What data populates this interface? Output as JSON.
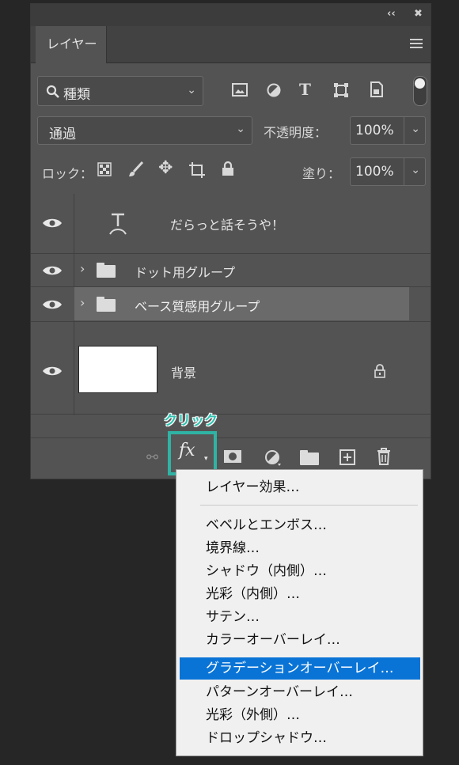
{
  "panel": {
    "topbar": {
      "collapse_label": "‹‹",
      "close_label": "✖"
    },
    "tab_label": "レイヤー",
    "filter": {
      "label": "種類"
    },
    "blend_mode": "通過",
    "opacity": {
      "label": "不透明度：",
      "value": "100%"
    },
    "lock": {
      "label": "ロック："
    },
    "fill": {
      "label": "塗り：",
      "value": "100%"
    },
    "layers": [
      {
        "name": "だらっと話そうや！",
        "type": "text"
      },
      {
        "name": "ドット用グループ",
        "type": "group"
      },
      {
        "name": "ベース質感用グループ",
        "type": "group",
        "selected": true
      },
      {
        "name": "背景",
        "type": "background",
        "locked": true
      }
    ],
    "fx_label": "fx"
  },
  "callout": "クリック",
  "fx_menu": {
    "items": [
      "レイヤー効果…",
      "ベベルとエンボス…",
      "境界線…",
      "シャドウ（内側）…",
      "光彩（内側）…",
      "サテン…",
      "カラーオーバーレイ…",
      "グラデーションオーバーレイ…",
      "パターンオーバーレイ…",
      "光彩（外側）…",
      "ドロップシャドウ…"
    ],
    "selected_index": 7
  },
  "colors": {
    "highlight": "#0a74d6",
    "callout": "#2fb3a4",
    "panel": "#535353"
  }
}
